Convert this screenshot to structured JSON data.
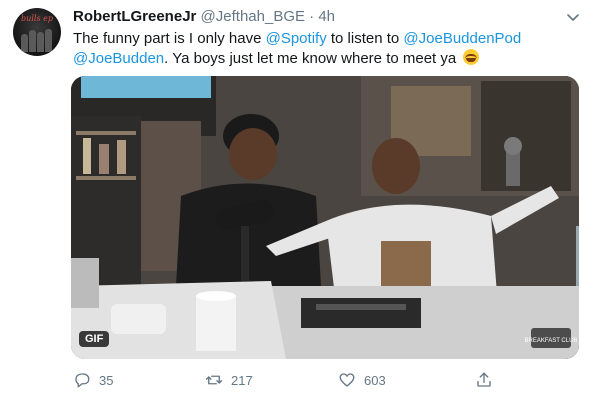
{
  "tweet": {
    "display_name": "RobertLGreeneJr",
    "handle": "@Jefthah_BGE",
    "separator": "·",
    "time": "4h",
    "text_segments": {
      "t1": "The funny part is I only have ",
      "m1": "@Spotify",
      "t2": " to listen to ",
      "m2": "@JoeBuddenPod",
      "m3": "@JoeBudden",
      "t3": ". Ya boys just let me know where to meet ya "
    },
    "avatar_text": "bulls ep",
    "media_badge": "GIF",
    "media_watermark": "BREAKFAST CLUB",
    "stats": {
      "replies": "35",
      "retweets": "217",
      "likes": "603"
    },
    "icons": {
      "reply": "reply-icon",
      "retweet": "retweet-icon",
      "like": "heart-icon",
      "share": "share-icon",
      "more": "chevron-down-icon"
    },
    "colors": {
      "mention": "#1b95e0",
      "meta": "#657786",
      "text": "#14171a"
    }
  }
}
